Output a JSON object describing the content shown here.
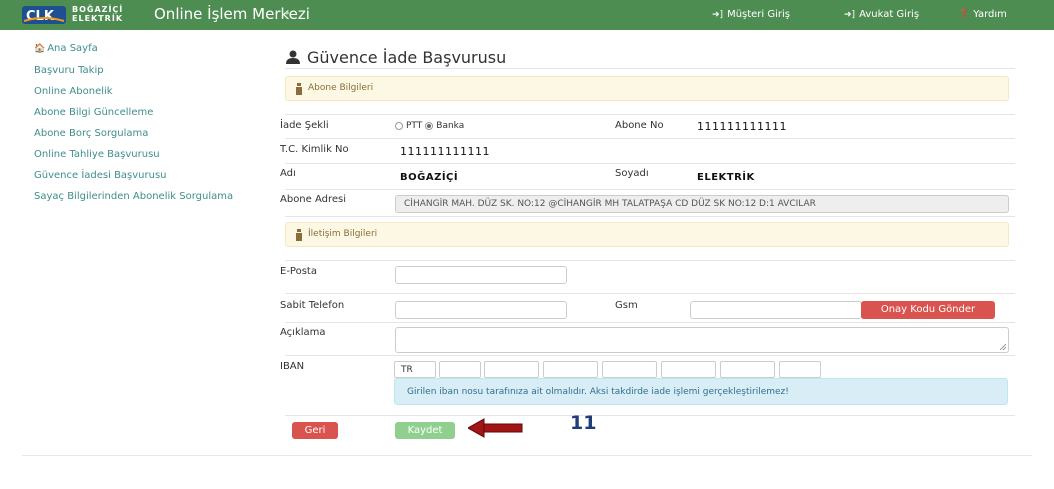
{
  "header": {
    "brand_line1": "BOĞAZİÇİ",
    "brand_line2": "ELEKTRİK",
    "title": "Online İşlem Merkezi",
    "nav": [
      {
        "label": "Müşteri Giriş",
        "icon": "login-icon"
      },
      {
        "label": "Avukat Giriş",
        "icon": "login-icon"
      },
      {
        "label": "Yardım",
        "icon": "help-icon"
      }
    ]
  },
  "sidebar": {
    "items": [
      {
        "label": "Ana Sayfa",
        "icon": "home-icon"
      },
      {
        "label": "Başvuru Takip"
      },
      {
        "label": "Online Abonelik"
      },
      {
        "label": "Abone Bilgi Güncelleme"
      },
      {
        "label": "Abone Borç Sorgulama"
      },
      {
        "label": "Online Tahliye Başvurusu"
      },
      {
        "label": "Güvence İadesi Başvurusu"
      },
      {
        "label": "Sayaç Bilgilerinden Abonelik Sorgulama"
      }
    ]
  },
  "main": {
    "title": "Güvence İade Başvurusu",
    "section_subscriber": "Abone Bilgileri",
    "section_contact": "İletişim Bilgileri",
    "fields": {
      "iade_sekli_label": "İade Şekli",
      "option_ptt": "PTT",
      "option_banka": "Banka",
      "selected_option": "Banka",
      "abone_no_label": "Abone No",
      "abone_no_value": "111111111111",
      "tc_label": "T.C. Kimlik No",
      "tc_value": "111111111111",
      "adi_label": "Adı",
      "adi_value": "BOĞAZİÇİ",
      "soyadi_label": "Soyadı",
      "soyadi_value": "ELEKTRİK",
      "adres_label": "Abone Adresi",
      "adres_value": "CİHANGİR MAH. DÜZ SK. NO:12 @CİHANGİR MH TALATPAŞA CD DÜZ SK NO:12 D:1 AVCILAR",
      "eposta_label": "E-Posta",
      "sabit_label": "Sabit Telefon",
      "gsm_label": "Gsm",
      "aciklama_label": "Açıklama",
      "iban_label": "IBAN",
      "iban_prefix": "TR"
    },
    "onay_button": "Onay Kodu Gönder",
    "iban_info": "Girilen iban nosu tarafınıza ait olmalıdır. Aksi takdirde iade işlemi gerçekleştirilemez!",
    "back_button": "Geri",
    "save_button": "Kaydet",
    "annotation_number": "11"
  },
  "colors": {
    "header_green": "#4e8d52",
    "link_teal": "#3e8e8c",
    "danger_red": "#d9534f",
    "success_green": "#8fd08f",
    "warning_bg": "#fcf8e3",
    "info_bg": "#d9edf7",
    "arrow_red": "#a31515"
  }
}
